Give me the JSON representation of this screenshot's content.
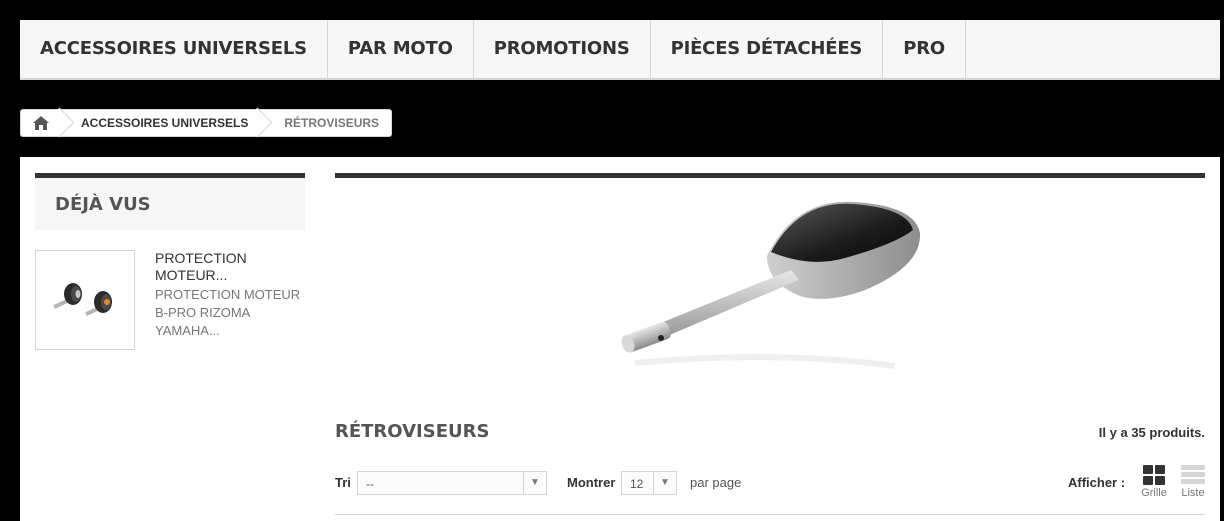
{
  "nav": {
    "items": [
      "ACCESSOIRES UNIVERSELS",
      "PAR MOTO",
      "PROMOTIONS",
      "PIÈCES DÉTACHÉES",
      "PRO"
    ]
  },
  "breadcrumb": {
    "home_icon": "home-icon",
    "items": [
      "ACCESSOIRES UNIVERSELS",
      "RÉTROVISEURS"
    ]
  },
  "sidebar": {
    "title": "DÉJÀ VUS",
    "viewed": [
      {
        "name": "PROTECTION MOTEUR...",
        "description": "PROTECTION MOTEUR B-PRO RIZOMA YAMAHA..."
      }
    ]
  },
  "category": {
    "title": "RÉTROVISEURS",
    "count_text": "Il y a 35 produits."
  },
  "toolbar": {
    "sort_label": "Tri",
    "sort_value": "--",
    "show_label": "Montrer",
    "show_value": "12",
    "per_page_label": "par page",
    "display_label": "Afficher :",
    "grid_label": "Grille",
    "list_label": "Liste"
  },
  "colors": {
    "page_background": "#000000",
    "nav_background": "#f6f6f6",
    "border": "#d6d4d4",
    "text_dark": "#333333",
    "text_muted": "#777777"
  }
}
